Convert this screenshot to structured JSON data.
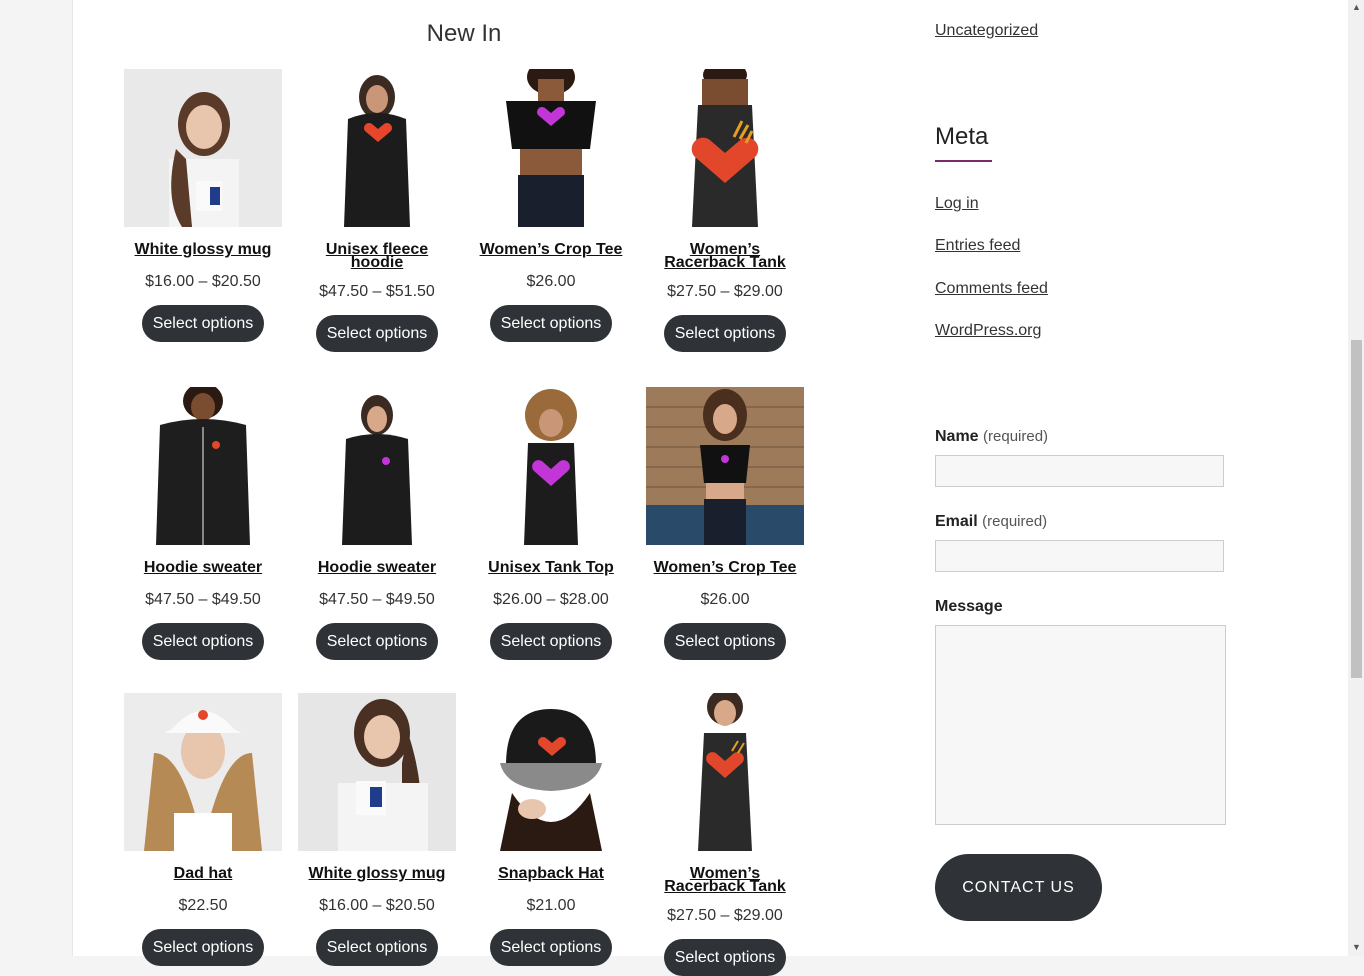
{
  "section": {
    "title": "New In"
  },
  "products": [
    {
      "title": "White glossy mug",
      "price": "$16.00 – $20.50",
      "button": "Select options"
    },
    {
      "title": "Unisex fleece hoodie",
      "price": "$47.50 – $51.50",
      "button": "Select options"
    },
    {
      "title": "Women’s Crop Tee",
      "price": "$26.00",
      "button": "Select options"
    },
    {
      "title": "Women’s Racerback Tank",
      "price": "$27.50 – $29.00",
      "button": "Select options"
    },
    {
      "title": "Hoodie sweater",
      "price": "$47.50 – $49.50",
      "button": "Select options"
    },
    {
      "title": "Hoodie sweater",
      "price": "$47.50 – $49.50",
      "button": "Select options"
    },
    {
      "title": "Unisex Tank Top",
      "price": "$26.00 – $28.00",
      "button": "Select options"
    },
    {
      "title": "Women’s Crop Tee",
      "price": "$26.00",
      "button": "Select options"
    },
    {
      "title": "Dad hat",
      "price": "$22.50",
      "button": "Select options"
    },
    {
      "title": "White glossy mug",
      "price": "$16.00 – $20.50",
      "button": "Select options"
    },
    {
      "title": "Snapback Hat",
      "price": "$21.00",
      "button": "Select options"
    },
    {
      "title": "Women’s Racerback Tank",
      "price": "$27.50 – $29.00",
      "button": "Select options"
    }
  ],
  "sidebar": {
    "category_link": "Uncategorized",
    "meta": {
      "title": "Meta",
      "links": [
        "Log in",
        "Entries feed",
        "Comments feed",
        "WordPress.org"
      ]
    },
    "form": {
      "name_label": "Name",
      "name_required": "(required)",
      "email_label": "Email",
      "email_required": "(required)",
      "message_label": "Message",
      "submit": "CONTACT US"
    }
  },
  "colors": {
    "button_bg": "#2f3337",
    "accent": "#7a2a6e"
  }
}
